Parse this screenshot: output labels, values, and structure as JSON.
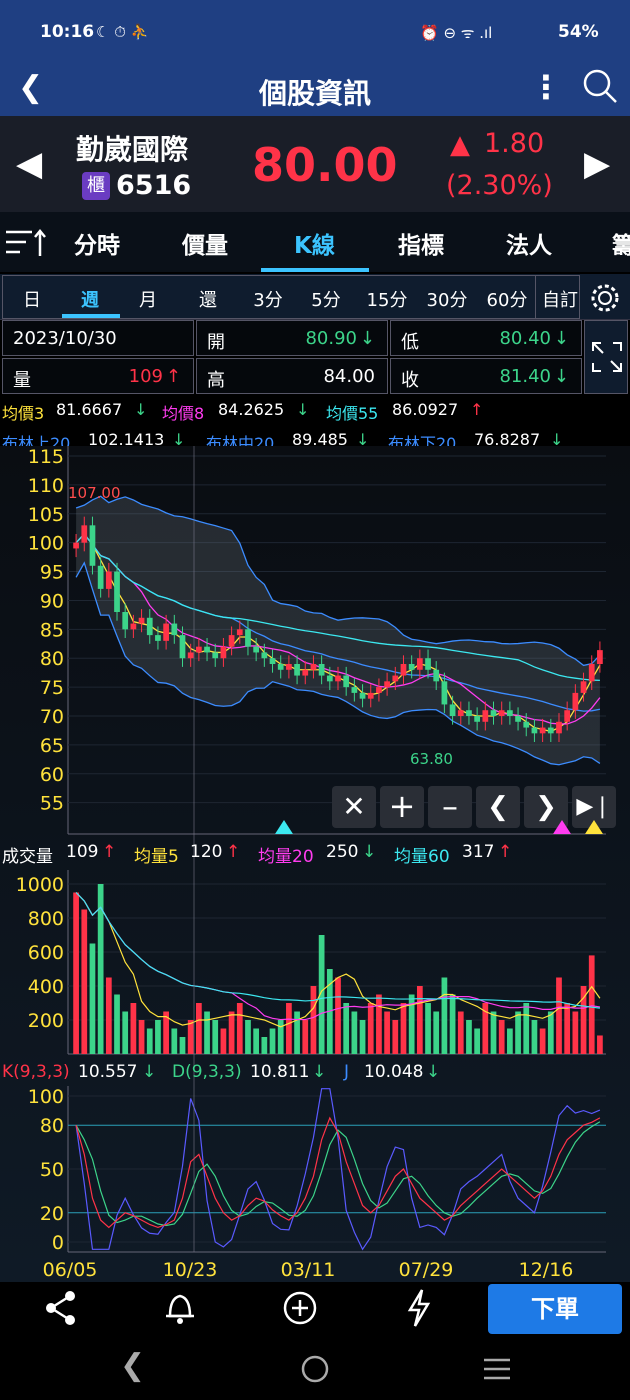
{
  "status": {
    "time": "10:16",
    "left_icons": "☾ ⏱ ⛹",
    "right_icons": "⏰ ⊖ ᯤ .ıl",
    "battery": "54%"
  },
  "header": {
    "title": "個股資訊"
  },
  "quote": {
    "name": "勤崴國際",
    "market_badge": "櫃",
    "code": "6516",
    "price": "80.00",
    "change": "1.80",
    "change_pct": "(2.30%)"
  },
  "tabs": [
    "分時",
    "價量",
    "K線",
    "指標",
    "法人",
    "籌"
  ],
  "periods": [
    "日",
    "週",
    "月",
    "還",
    "3分",
    "5分",
    "15分",
    "30分",
    "60分",
    "自訂"
  ],
  "selected_period": "週",
  "info": {
    "date": "2023/10/30",
    "open_label": "開",
    "open": "80.90",
    "low_label": "低",
    "low": "80.40",
    "volume_label": "量",
    "volume": "109",
    "high_label": "高",
    "high": "84.00",
    "close_label": "收",
    "close": "81.40",
    "colors": {
      "up": "#ff3348",
      "down": "#3cd48a"
    }
  },
  "ma": {
    "ma3_label": "均價3",
    "ma3": "81.6667",
    "ma8_label": "均價8",
    "ma8": "84.2625",
    "ma55_label": "均價55",
    "ma55": "86.0927",
    "bb_up_label": "布林上20",
    "bb_up": "102.1413",
    "bb_mid_label": "布林中20",
    "bb_mid": "89.485",
    "bb_low_label": "布林下20",
    "bb_low": "76.8287"
  },
  "vol_legend": {
    "label": "成交量",
    "value": "109",
    "v5_label": "均量5",
    "v5": "120",
    "v20_label": "均量20",
    "v20": "250",
    "v60_label": "均量60",
    "v60": "317"
  },
  "kd_legend": {
    "k_label": "K(9,3,3)",
    "k": "10.557",
    "d_label": "D(9,3,3)",
    "d": "10.811",
    "j_label": "J",
    "j": "10.048"
  },
  "chart_data": {
    "type": "candlestick",
    "price_axis": {
      "ticks": [
        "115",
        "110",
        "105",
        "100",
        "95",
        "90",
        "85",
        "80",
        "75",
        "70",
        "65",
        "60",
        "55"
      ],
      "min": 52,
      "max": 115
    },
    "max_label": "107.00",
    "min_label": "63.80",
    "volume_axis": {
      "ticks": [
        "1000",
        "800",
        "600",
        "400",
        "200"
      ],
      "min": 0,
      "max": 1000
    },
    "kd_axis": {
      "ticks": [
        "100",
        "80",
        "50",
        "20",
        "0"
      ],
      "min": 0,
      "max": 100
    },
    "x_labels": [
      "06/05",
      "10/23",
      "03/11",
      "07/29",
      "12/16"
    ],
    "close": [
      100,
      103,
      96,
      92,
      95,
      88,
      85,
      86,
      87,
      84,
      83,
      86,
      84,
      80,
      81,
      82,
      81,
      80,
      82,
      84,
      85,
      82,
      81,
      80,
      79,
      78,
      79,
      77,
      78,
      79,
      77,
      76,
      77,
      75,
      74,
      73,
      74,
      75,
      76,
      77,
      79,
      78,
      80,
      78,
      76,
      72,
      70,
      71,
      70,
      69,
      71,
      70,
      71,
      70,
      69,
      68,
      67,
      68,
      67,
      69,
      71,
      74,
      76,
      79,
      81.4
    ],
    "volume": [
      950,
      850,
      650,
      1000,
      450,
      350,
      250,
      300,
      200,
      150,
      200,
      250,
      150,
      100,
      200,
      300,
      250,
      200,
      150,
      250,
      300,
      200,
      150,
      100,
      150,
      200,
      300,
      250,
      200,
      400,
      700,
      500,
      450,
      300,
      250,
      200,
      300,
      350,
      250,
      200,
      300,
      350,
      400,
      300,
      250,
      450,
      350,
      250,
      200,
      150,
      300,
      250,
      200,
      150,
      250,
      300,
      200,
      150,
      250,
      450,
      300,
      250,
      400,
      580,
      109
    ],
    "kd_k": [
      80,
      60,
      30,
      15,
      10,
      15,
      20,
      18,
      15,
      12,
      10,
      12,
      15,
      30,
      55,
      60,
      45,
      30,
      20,
      15,
      18,
      25,
      30,
      28,
      22,
      18,
      15,
      20,
      30,
      45,
      70,
      85,
      75,
      55,
      40,
      25,
      20,
      25,
      35,
      45,
      50,
      40,
      30,
      25,
      20,
      15,
      18,
      25,
      30,
      35,
      40,
      45,
      50,
      45,
      40,
      35,
      30,
      35,
      45,
      60,
      70,
      75,
      80,
      82,
      85
    ]
  }
}
